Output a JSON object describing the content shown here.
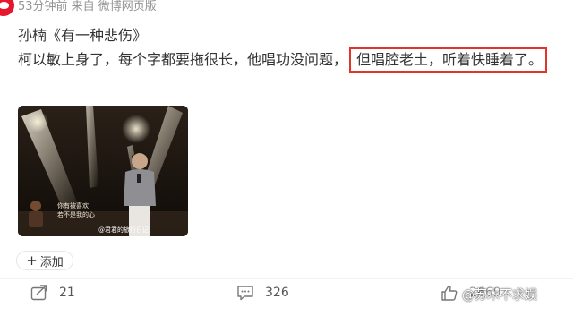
{
  "meta": {
    "text": "53分钟前  来自 微博网页版"
  },
  "post": {
    "title": "孙楠《有一种悲伤》",
    "body_prefix": "柯以敏上身了，每个字都要拖很长，他唱功没问题，",
    "body_highlight": "但唱腔老土，听着快睡着了。"
  },
  "media": {
    "caption_line1": "你有被喜欢",
    "caption_line2": "若不是我的心",
    "watermark": "@君君的旅行日记"
  },
  "tags": {
    "add_label": "添加"
  },
  "actions": {
    "reposts": "21",
    "comments": "326",
    "likes": "2669"
  },
  "overlay": {
    "watermark": "@苏木不求娱"
  },
  "colors": {
    "brand_red": "#e6162d",
    "highlight_border": "#e0352b",
    "meta_gray": "#939393"
  }
}
